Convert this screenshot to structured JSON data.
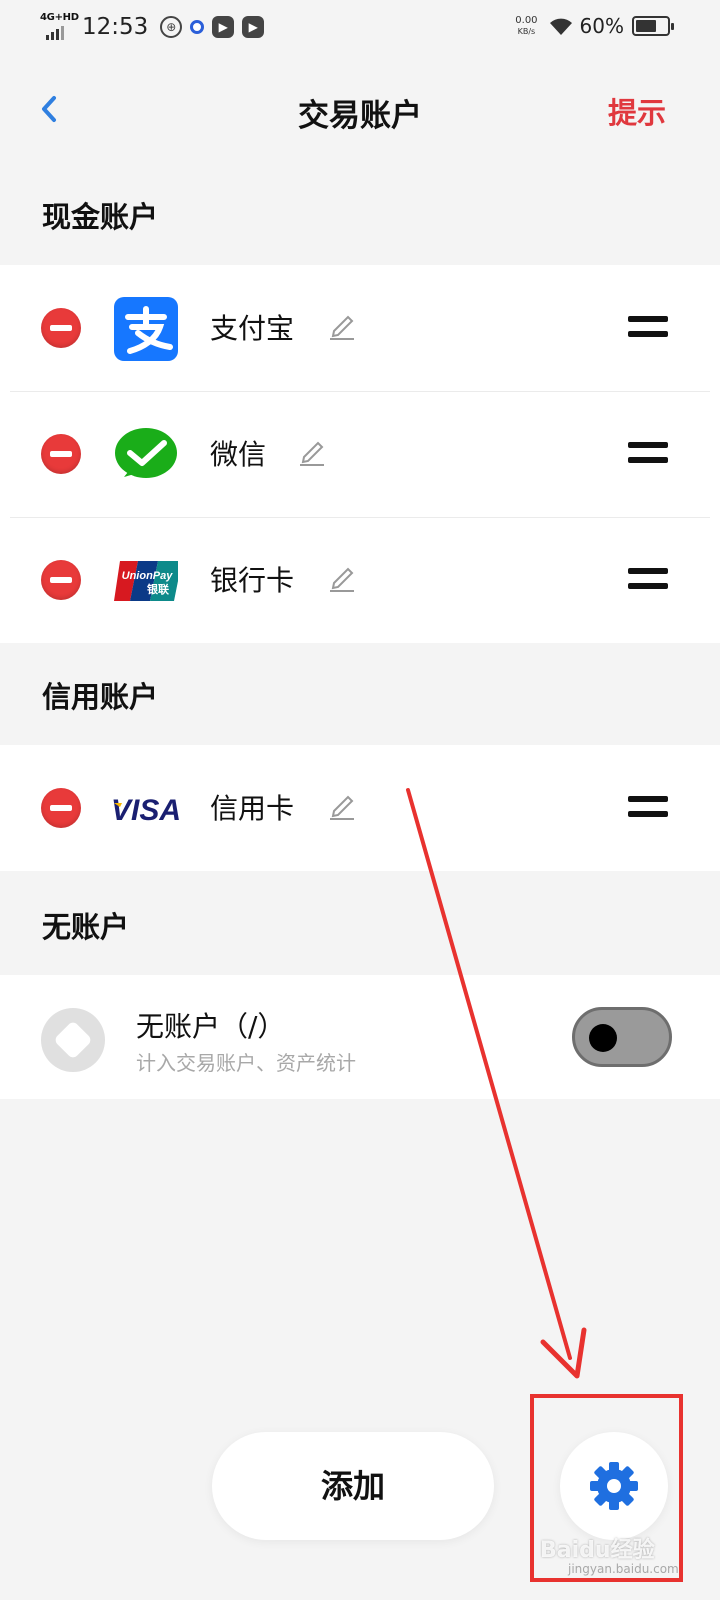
{
  "status_bar": {
    "network": "4G+HD",
    "time": "12:53",
    "speed_value": "0.00",
    "speed_unit": "KB/s",
    "battery": "60%"
  },
  "header": {
    "title": "交易账户",
    "tip": "提示"
  },
  "sections": {
    "cash": {
      "title": "现金账户",
      "items": [
        {
          "label": "支付宝",
          "icon": "alipay-logo"
        },
        {
          "label": "微信",
          "icon": "wechat-logo"
        },
        {
          "label": "银行卡",
          "icon": "unionpay-logo",
          "logo_text_1": "UnionPay",
          "logo_text_2": "银联"
        }
      ]
    },
    "credit": {
      "title": "信用账户",
      "items": [
        {
          "label": "信用卡",
          "icon": "visa-logo",
          "logo_text": "VISA"
        }
      ]
    },
    "none": {
      "title": "无账户",
      "item": {
        "name": "无账户（/）",
        "subtitle": "计入交易账户、资产统计",
        "toggle_on": false
      }
    }
  },
  "footer": {
    "add_label": "添加"
  },
  "watermark": {
    "text": "Baidu经验",
    "url": "jingyan.baidu.com"
  },
  "colors": {
    "accent_blue": "#2f7fe0",
    "tip_red": "#e0383e",
    "annotation_red": "#e8322f"
  }
}
